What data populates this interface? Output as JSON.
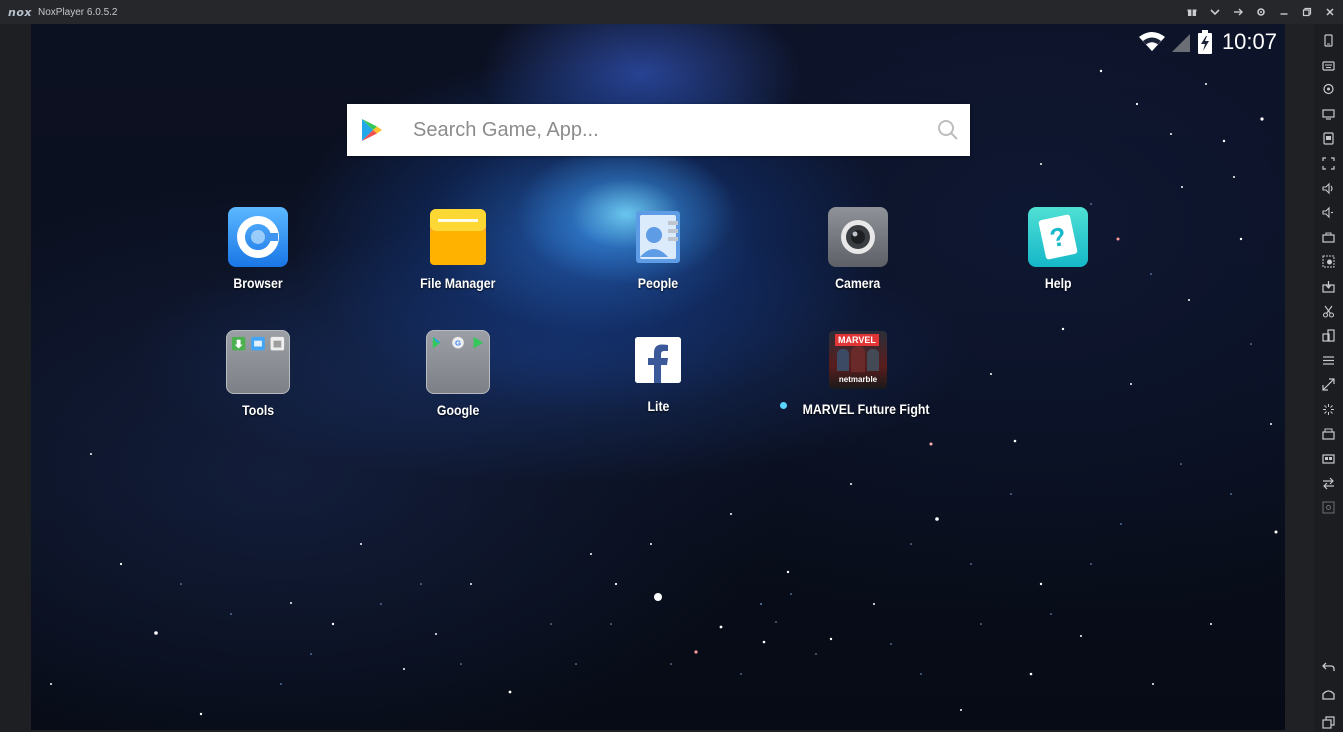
{
  "titlebar": {
    "logo": "nox",
    "title": "NoxPlayer 6.0.5.2",
    "controls": [
      "gift-icon",
      "chevron-down-icon",
      "pin-icon",
      "gear-icon",
      "minimize-icon",
      "restore-icon",
      "close-icon"
    ]
  },
  "status_bar": {
    "time": "10:07",
    "icons": [
      "wifi-icon",
      "signal-icon",
      "battery-charging-icon"
    ]
  },
  "search": {
    "placeholder": "Search Game, App..."
  },
  "apps": [
    {
      "label": "Browser"
    },
    {
      "label": "File Manager"
    },
    {
      "label": "People"
    },
    {
      "label": "Camera"
    },
    {
      "label": "Help"
    },
    {
      "label": "Tools"
    },
    {
      "label": "Google"
    },
    {
      "label": "Lite"
    },
    {
      "label": "MARVEL Future Fight",
      "icon_text": "MARVEL",
      "icon_subtext": "netmarble"
    }
  ],
  "sidebar": {
    "tools": [
      "phone-icon",
      "keyboard-icon",
      "location-icon",
      "screen-icon",
      "apk-icon",
      "fullscreen-icon",
      "volume-up-icon",
      "volume-down-icon",
      "toolbox-icon",
      "screenshot-icon",
      "import-icon",
      "scissors-icon",
      "multi-instance-icon",
      "menu-icon",
      "resize-icon",
      "shake-icon",
      "record-icon",
      "macro-icon",
      "sync-icon",
      "more-icon"
    ],
    "nav": [
      "back-icon",
      "home-icon",
      "recent-apps-icon"
    ]
  },
  "colors": {
    "titlebar_bg": "#26272b",
    "sidebar_bg": "#1c1d21",
    "accent_dot": "#5ad3ff"
  }
}
